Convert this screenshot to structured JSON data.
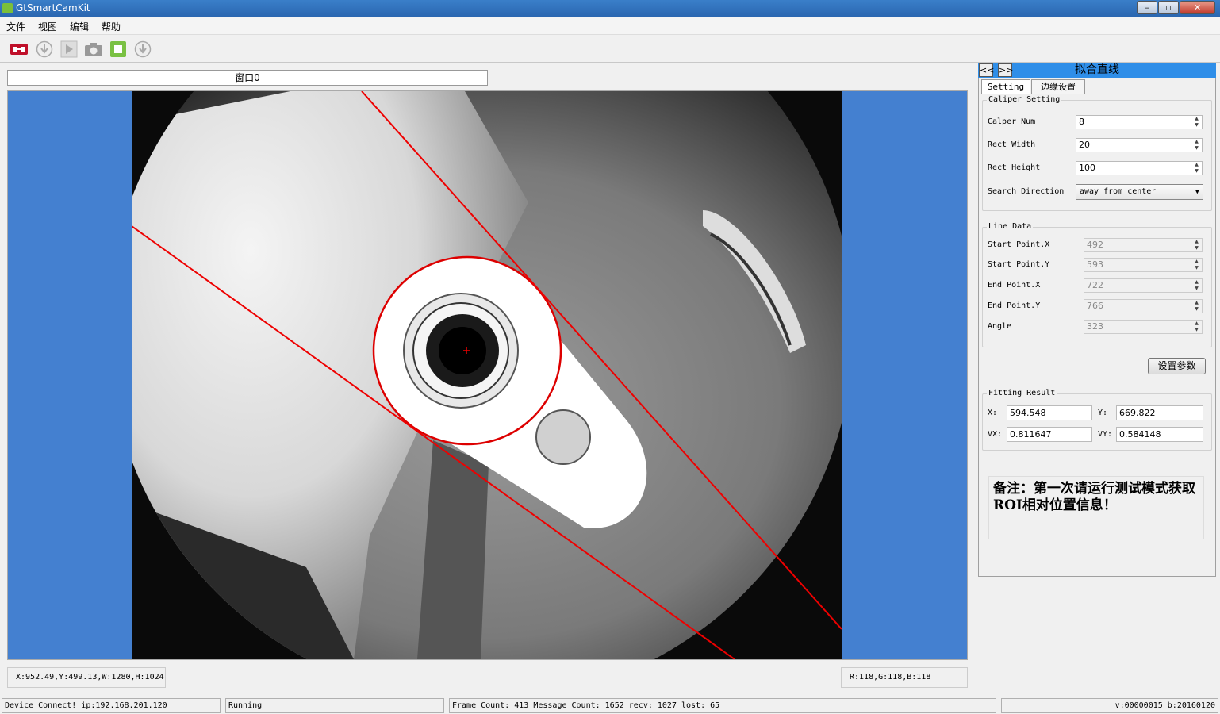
{
  "window": {
    "title": "GtSmartCamKit"
  },
  "menu": {
    "items": [
      "文件",
      "视图",
      "编辑",
      "帮助"
    ]
  },
  "toolbar": {
    "icons": [
      "connect-icon",
      "download-icon",
      "play-icon",
      "camera-icon",
      "stop-icon",
      "download-alt-icon"
    ]
  },
  "viewer": {
    "tab_label": "窗口0"
  },
  "status_bottom": {
    "coords": "X:952.49,Y:499.13,W:1280,H:1024",
    "rgb": "R:118,G:118,B:118"
  },
  "statusbar": {
    "device": "Device Connect! ip:192.168.201.120",
    "state": "Running",
    "frames": "Frame Count: 413 Message Count: 1652  recv: 1027  lost: 65",
    "version": "v:00000015 b:20160120"
  },
  "panel": {
    "title": "拟合直线",
    "nav_prev": "<<",
    "nav_next": ">>",
    "tabs": [
      "Setting",
      "边缘设置"
    ],
    "caliper": {
      "title": "Caliper Setting",
      "calper_num_label": "Calper Num",
      "calper_num": "8",
      "rect_width_label": "Rect Width",
      "rect_width": "20",
      "rect_height_label": "Rect Height",
      "rect_height": "100",
      "search_direction_label": "Search Direction",
      "search_direction": "away from center"
    },
    "line_data": {
      "title": "Line Data",
      "start_x_label": "Start Point.X",
      "start_x": "492",
      "start_y_label": "Start Point.Y",
      "start_y": "593",
      "end_x_label": "End Point.X",
      "end_x": "722",
      "end_y_label": "End Point.Y",
      "end_y": "766",
      "angle_label": "Angle",
      "angle": "323"
    },
    "set_params_button": "设置参数",
    "fitting": {
      "title": "Fitting Result",
      "x_label": "X:",
      "x": "594.548",
      "y_label": "Y:",
      "y": "669.822",
      "vx_label": "VX:",
      "vx": "0.811647",
      "vy_label": "VY:",
      "vy": "0.584148"
    },
    "note": "备注：第一次请运行测试模式获取ROI相对位置信息！"
  }
}
